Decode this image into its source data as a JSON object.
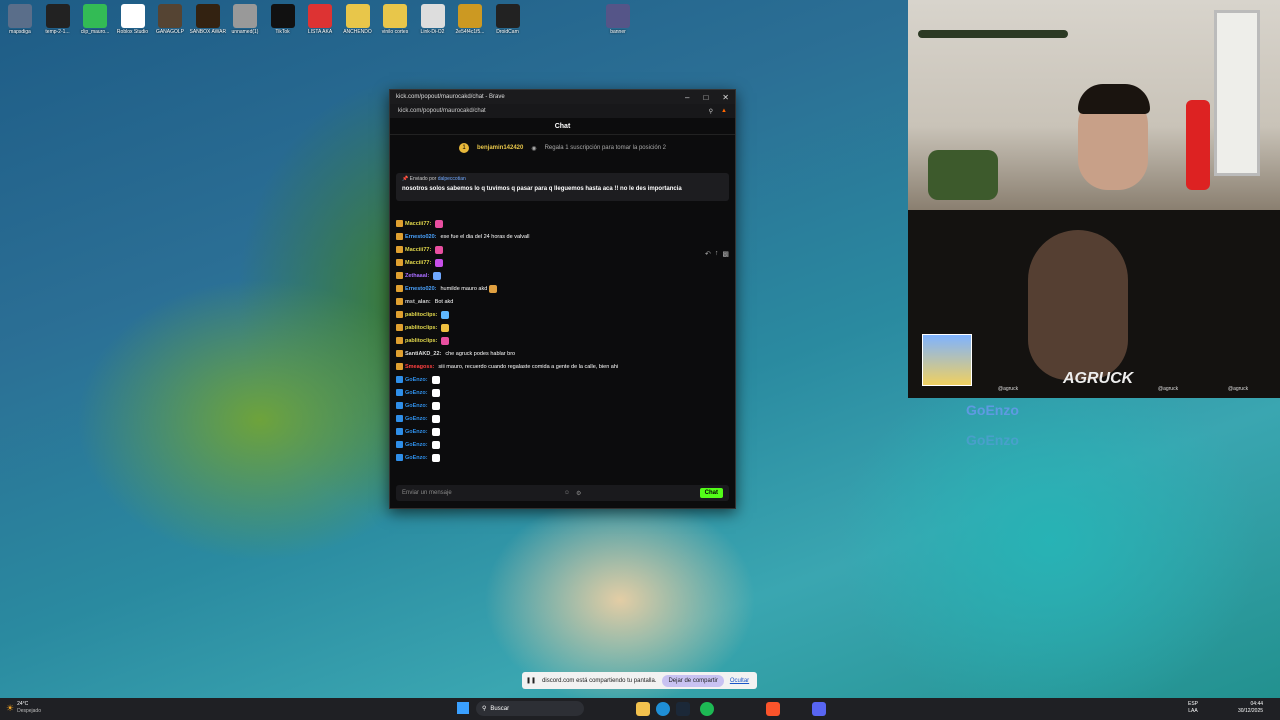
{
  "desktop_icons": [
    {
      "label": "mapsdiga",
      "color": "#5a6e8a"
    },
    {
      "label": "temp-2-1...",
      "color": "#222"
    },
    {
      "label": "clip_mauro...",
      "color": "#3b5"
    },
    {
      "label": "Roblox Studio",
      "color": "#fff"
    },
    {
      "label": "GANAGOLP",
      "color": "#554433"
    },
    {
      "label": "SANBOX AWARD",
      "color": "#332211"
    },
    {
      "label": "unnamed(1)",
      "color": "#999"
    },
    {
      "label": "TikTok",
      "color": "#111"
    },
    {
      "label": "LISTA AKA",
      "color": "#d33"
    },
    {
      "label": "ANCHENDO",
      "color": "#e8c64a"
    },
    {
      "label": "vinilo cortes",
      "color": "#e8c64a"
    },
    {
      "label": "Link-Di-O2",
      "color": "#ddd"
    },
    {
      "label": "2e54f4c1f5...",
      "color": "#c92"
    },
    {
      "label": "DroidCam",
      "color": "#222"
    },
    {
      "label": "banner",
      "color": "#558"
    }
  ],
  "browser": {
    "title": "kick.com/popout/maurocakd/chat - Brave",
    "url": "kick.com/popout/maurocakd/chat",
    "chat_title": "Chat",
    "top_gifter": "benjamin142420",
    "top_gifter_count": "1",
    "gift_prompt": "Regala 1 suscripción para tomar la posición 2",
    "pinned_by_label": "Enviado por",
    "pinned_by_user": "dalpeccotian",
    "pinned_text": "nosotros solos sabemos lo q tuvimos q pasar para q lleguemos hasta aca !! no le des importancia",
    "input_placeholder": "Enviar un mensaje",
    "send_label": "Chat"
  },
  "messages": [
    {
      "user": "Macciii77:",
      "color": "#e2d84c",
      "text": "",
      "emote": "#e94fa0"
    },
    {
      "user": "Ernesto020:",
      "color": "#4aa3ff",
      "text": "ese fue el dia del 24 horas de valvall",
      "emote": ""
    },
    {
      "user": "Macciii77:",
      "color": "#e2d84c",
      "text": "",
      "emote": "#e94fa0"
    },
    {
      "user": "Macciii77:",
      "color": "#e2d84c",
      "text": "",
      "emote": "#c84fe9"
    },
    {
      "user": "Zethaaal:",
      "color": "#a86cff",
      "text": "",
      "emote": "#6fa8ff"
    },
    {
      "user": "Ernesto020:",
      "color": "#4aa3ff",
      "text": "humilde mauro akd",
      "emote": "#e0a040"
    },
    {
      "user": "mst_alan:",
      "color": "#cccccc",
      "text": "Bot akd",
      "emote": ""
    },
    {
      "user": "pablitoclips:",
      "color": "#e2d84c",
      "text": "",
      "emote": "#5fb8ff"
    },
    {
      "user": "pablitoclips:",
      "color": "#e2d84c",
      "text": "",
      "emote": "#f0c040"
    },
    {
      "user": "pablitoclips:",
      "color": "#e2d84c",
      "text": "",
      "emote": "#e94fa0"
    },
    {
      "user": "SantiAKD_22:",
      "color": "#dddddd",
      "text": "che agruck podes hablar bro",
      "emote": ""
    },
    {
      "user": "Smeagoss:",
      "color": "#ff4040",
      "text": "siii mauro, recuerdo cuando regalaste comida a gente de la calle, bien ahi",
      "emote": ""
    },
    {
      "user": "GoEnzo:",
      "color": "#2f8fe9",
      "text": "",
      "emote": "#ffffff"
    },
    {
      "user": "GoEnzo:",
      "color": "#2f8fe9",
      "text": "",
      "emote": "#ffffff"
    },
    {
      "user": "GoEnzo:",
      "color": "#2f8fe9",
      "text": "",
      "emote": "#ffffff"
    },
    {
      "user": "GoEnzo:",
      "color": "#2f8fe9",
      "text": "",
      "emote": "#ffffff"
    },
    {
      "user": "GoEnzo:",
      "color": "#2f8fe9",
      "text": "",
      "emote": "#ffffff"
    },
    {
      "user": "GoEnzo:",
      "color": "#2f8fe9",
      "text": "",
      "emote": "#ffffff"
    },
    {
      "user": "GoEnzo:",
      "color": "#2f8fe9",
      "text": "",
      "emote": "#ffffff"
    }
  ],
  "webcam": {
    "overlay_name": "AGRUCK",
    "handle_left": "@agruck",
    "handle_mid": "@agruck",
    "handle_right": "@agruck",
    "watermark": "GoEnzo"
  },
  "sharebar": {
    "text": "discord.com está compartiendo tu pantalla.",
    "stop_label": "Dejar de compartir",
    "hide_label": "Ocultar"
  },
  "taskbar": {
    "weather_temp": "24°C",
    "weather_desc": "Despejado",
    "search_label": "Buscar",
    "lang": "ESP",
    "lang_sub": "LAA",
    "time": "04:44",
    "date": "30/12/2025"
  }
}
